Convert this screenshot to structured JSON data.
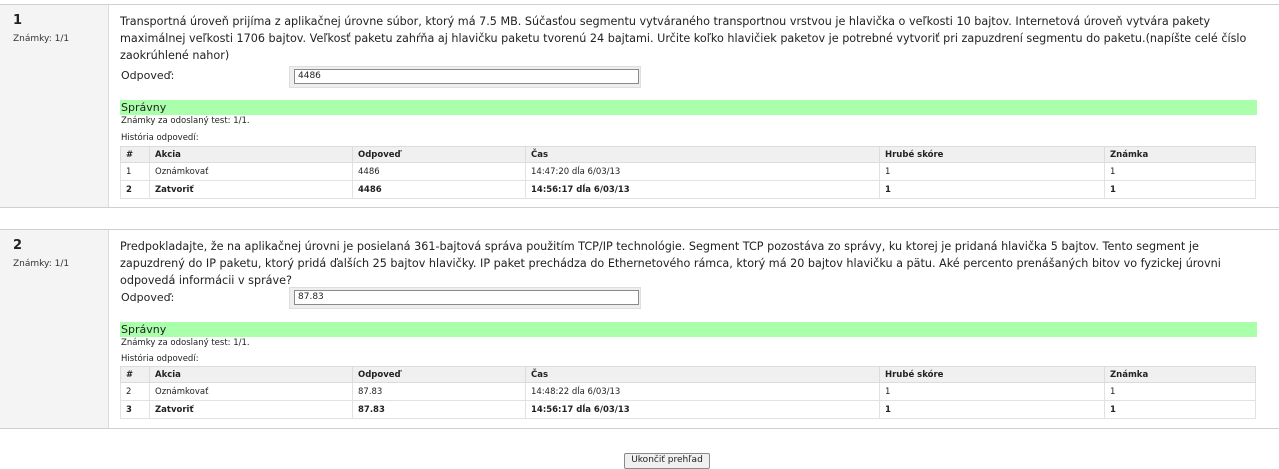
{
  "questions": [
    {
      "number": "1",
      "grade": "Známky: 1/1",
      "text": "Transportná úroveň prijíma z aplikačnej úrovne súbor, ktorý má 7.5 MB. Súčasťou segmentu vytváraného transportnou vrstvou je hlavička o veľkosti 10 bajtov. Internetová úroveň vytvára pakety maximálnej veľkosti 1706 bajtov. Veľkosť paketu zahŕňa aj hlavičku paketu tvorenú 24 bajtami. Určite koľko hlavičiek paketov je potrebné vytvoriť pri zapuzdrení segmentu do paketu.(napíšte celé číslo zaokrúhlené nahor)",
      "answer_label": "Odpoveď:",
      "answer_value": "4486",
      "feedback": "Správny",
      "marks_submitted": "Známky za odoslaný test: 1/1.",
      "history_label": "História odpovedí:",
      "rows": [
        {
          "num": "1",
          "action": "Oznámkovať",
          "answer": "4486",
          "time": "14:47:20 dĺa 6/03/13",
          "raw": "1",
          "grade": "1"
        },
        {
          "num": "2",
          "action": "Zatvoriť",
          "answer": "4486",
          "time": "14:56:17 dĺa 6/03/13",
          "raw": "1",
          "grade": "1"
        }
      ]
    },
    {
      "number": "2",
      "grade": "Známky: 1/1",
      "text": "Predpokladajte, že na aplikačnej úrovni je posielaná 361-bajtová správa použitím TCP/IP technológie. Segment TCP pozostáva zo správy, ku ktorej je pridaná hlavička 5 bajtov. Tento segment je zapuzdrený do IP paketu, ktorý pridá ďalších 25 bajtov hlavičky. IP paket prechádza do Ethernetového rámca, ktorý má 20 bajtov hlavičku a pätu. Aké percento prenášaných bitov vo fyzickej úrovni odpovedá informácii v správe?",
      "answer_label": "Odpoveď:",
      "answer_value": "87.83",
      "feedback": "Správny",
      "marks_submitted": "Známky za odoslaný test: 1/1.",
      "history_label": "História odpovedí:",
      "rows": [
        {
          "num": "2",
          "action": "Oznámkovať",
          "answer": "87.83",
          "time": "14:48:22 dĺa 6/03/13",
          "raw": "1",
          "grade": "1"
        },
        {
          "num": "3",
          "action": "Zatvoriť",
          "answer": "87.83",
          "time": "14:56:17 dĺa 6/03/13",
          "raw": "1",
          "grade": "1"
        }
      ]
    }
  ],
  "table_headers": {
    "num": "#",
    "action": "Akcia",
    "answer": "Odpoveď",
    "time": "Čas",
    "raw": "Hrubé skóre",
    "grade": "Známka"
  },
  "finish_button": "Ukončiť prehľad",
  "colors": {
    "correct_bg": "#aaffaa",
    "question_bg": "#f4f4f4"
  }
}
